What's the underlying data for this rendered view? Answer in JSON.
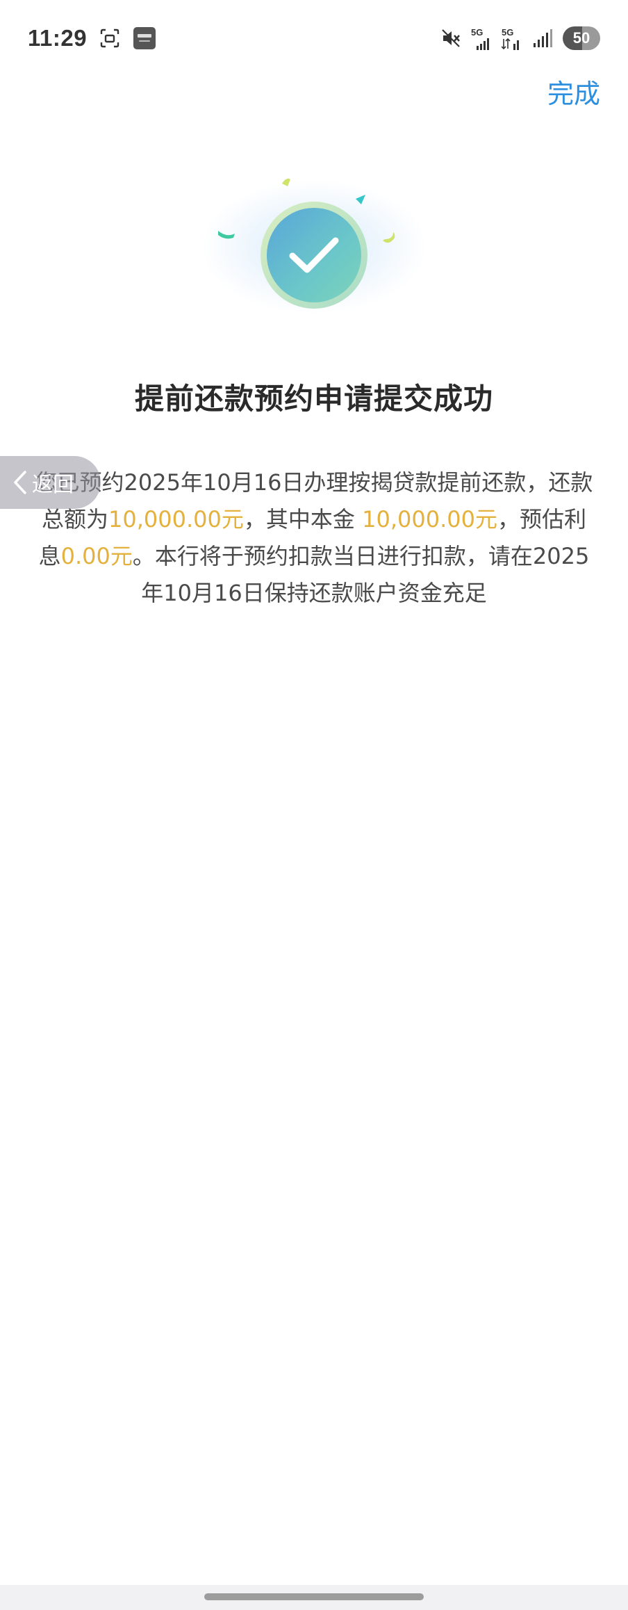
{
  "status_bar": {
    "time": "11:29",
    "signal_label_1": "5G",
    "signal_label_2": "5G",
    "battery": "50"
  },
  "header": {
    "done_label": "完成"
  },
  "title": "提前还款预约申请提交成功",
  "description": {
    "part1": "您已预约2025年10月16日办理按揭贷款提前还款，还款总额为",
    "total_amount": "10,000.00元",
    "part2": "，其中本金 ",
    "principal_amount": "10,000.00元",
    "part3": "，预估利息",
    "interest_amount": "0.00元",
    "part4": "。本行将于预约扣款当日进行扣款，请在2025年10月16日保持还款账户资金充足"
  },
  "floating_back": {
    "label": "返回"
  },
  "colors": {
    "accent": "#2d8fe0",
    "highlight": "#e3b13c"
  }
}
